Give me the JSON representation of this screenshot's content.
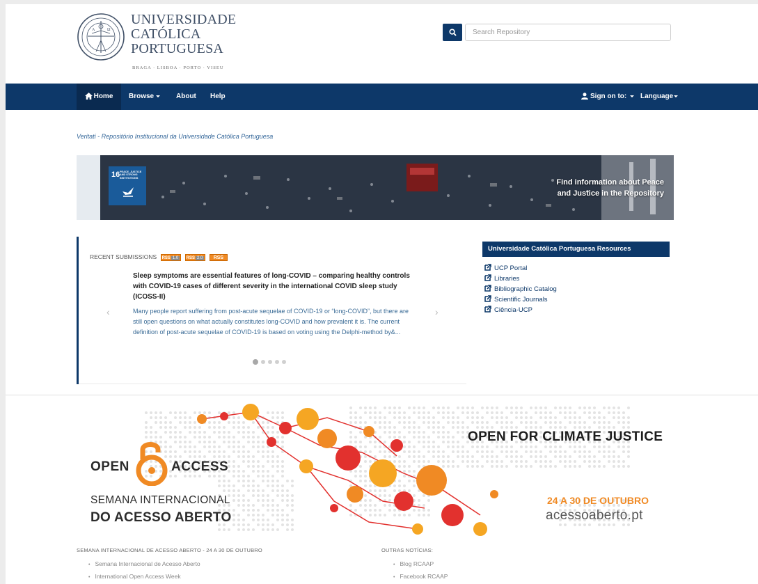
{
  "header": {
    "logo_lines": [
      "UNIVERSIDADE",
      "CATÓLICA",
      "PORTUGUESA"
    ],
    "logo_cities": "BRAGA · LISBOA · PORTO · VISEU",
    "search": {
      "placeholder": "Search Repository",
      "icon": "search-icon"
    }
  },
  "nav": {
    "home": "Home",
    "browse": "Browse",
    "about": "About",
    "help": "Help",
    "sign_on": "Sign on to:",
    "language": "Language"
  },
  "site_description": "Veritati - Repositório Institucional da Universidade Católica Portuguesa",
  "banner": {
    "sdg_number": "16",
    "sdg_text": "PEACE, JUSTICE AND STRONG INSTITUTIONS",
    "line1": "Find information about Peace",
    "line2": "and Justice in the Repository"
  },
  "recent": {
    "heading": "RECENT SUBMISSIONS",
    "badges": [
      "RSS",
      "1.0",
      "RSS",
      "2.0",
      "RSS"
    ],
    "title": "Sleep symptoms are essential features of long-COVID – comparing healthy controls with COVID-19 cases of different severity in the international COVID sleep study (ICOSS-II)",
    "abstract": "Many people report suffering from post-acute sequelae of COVID-19 or “long-COVID”, but there are still open questions on what actually constitutes long-COVID and how prevalent it is. The current definition of post-acute sequelae of COVID-19 is based on voting using the Delphi-method by&...",
    "prev": "‹",
    "next": "›",
    "slides": 5,
    "active_slide": 0
  },
  "resources": {
    "heading": "Universidade Católica Portuguesa Resources",
    "items": [
      "UCP Portal",
      "Libraries",
      "Bibliographic Catalog",
      "Scientific Journals",
      "Ciência-UCP"
    ]
  },
  "poster": {
    "open": "OPEN",
    "access": "ACCESS",
    "semana": "SEMANA INTERNACIONAL",
    "do_acesso": "DO ACESSO ABERTO",
    "climate": "OPEN FOR CLIMATE JUSTICE",
    "dates": "24 A 30 DE OUTUBRO",
    "site": "acessoaberto.pt",
    "colors": {
      "orange": "#f08a24",
      "red": "#e2312e"
    }
  },
  "news": {
    "left_heading": "SEMANA INTERNACIONAL DE ACESSO ABERTO - 24 A 30 DE OUTUBRO",
    "left_items": [
      "Semana Internacional de Acesso Aberto",
      "International Open Access Week"
    ],
    "right_heading": "OUTRAS NOTÍCIAS:",
    "right_items": [
      "Blog RCAAP",
      "Facebook RCAAP"
    ]
  },
  "colors": {
    "navy": "#0d3869",
    "link": "#336699"
  }
}
